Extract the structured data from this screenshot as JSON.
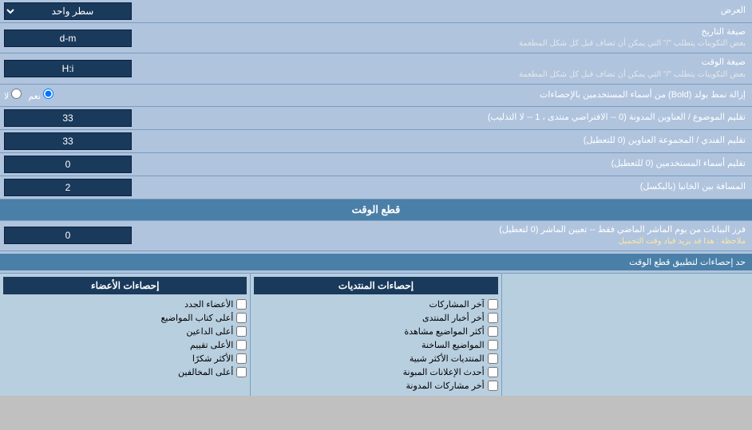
{
  "header": {
    "display_label": "العرض",
    "single_line_label": "سطر واحد"
  },
  "rows": [
    {
      "id": "date-format",
      "label": "صيغة التاريخ",
      "sublabel": "بعض التكوينات يتطلب \"/\" التي يمكن أن تضاف قبل كل شكل المطعمة",
      "value": "d-m",
      "type": "text"
    },
    {
      "id": "time-format",
      "label": "صيغة الوقت",
      "sublabel": "بعض التكوينات يتطلب \"/\" التي يمكن أن تضاف قبل كل شكل المطعمة",
      "value": "H:i",
      "type": "text"
    },
    {
      "id": "bold-usernames",
      "label": "إزالة نمط بولد (Bold) من أسماء المستخدمين بالإحصاءات",
      "value": "نعم",
      "type": "radio",
      "options": [
        "نعم",
        "لا"
      ],
      "selected": "نعم"
    },
    {
      "id": "forum-subject",
      "label": "تقليم الموضوع / العناوين المدونة (0 -- الافتراضي منتدى ، 1 -- لا التذليب)",
      "value": "33",
      "type": "text"
    },
    {
      "id": "forum-group",
      "label": "تقليم الفندي / المجموعة العناوين (0 للتعطيل)",
      "value": "33",
      "type": "text"
    },
    {
      "id": "user-names",
      "label": "تقليم أسماء المستخدمين (0 للتعطيل)",
      "value": "0",
      "type": "text"
    },
    {
      "id": "column-gap",
      "label": "المسافة بين الخانيا (بالبكسل)",
      "value": "2",
      "type": "text"
    }
  ],
  "cutoff_section": {
    "title": "قطع الوقت",
    "row_label": "فرز البيانات من يوم الماشر الماضي فقط -- تعيين الماشر (0 لتعطيل)",
    "row_note": "ملاحظة : هذا قد يزيد قياد وقت التحميل",
    "value": "0",
    "limit_label": "حد إحصاءات لتطبيق قطع الوقت"
  },
  "stats_headers": {
    "posts": "إحصاءات المنتديات",
    "members": "إحصاءات الأعضاء"
  },
  "stats_posts": [
    {
      "label": "آخر المشاركات",
      "checked": false
    },
    {
      "label": "أخر أخبار المنتدى",
      "checked": false
    },
    {
      "label": "أكثر المواضيع مشاهدة",
      "checked": false
    },
    {
      "label": "المواضيع الساخنة",
      "checked": false
    },
    {
      "label": "المنتديات الأكثر شبية",
      "checked": false
    },
    {
      "label": "أحدث الإعلانات المبونة",
      "checked": false
    },
    {
      "label": "أخر مشاركات المدونة",
      "checked": false
    }
  ],
  "stats_members": [
    {
      "label": "الأعضاء الجدد",
      "checked": false
    },
    {
      "label": "أعلى كتاب المواضيع",
      "checked": false
    },
    {
      "label": "أعلى الداعين",
      "checked": false
    },
    {
      "label": "الأعلى تقييم",
      "checked": false
    },
    {
      "label": "الأكثر شكرًا",
      "checked": false
    },
    {
      "label": "أعلى المخالفين",
      "checked": false
    }
  ],
  "stats_members_col1": [
    {
      "label": "الأعضاء الجدد",
      "checked": false
    },
    {
      "label": "أعلى كتاب المواضيع",
      "checked": false
    },
    {
      "label": "أعلى الداعين",
      "checked": false
    },
    {
      "label": "الأعلى تقييم",
      "checked": false
    },
    {
      "label": "الأكثر شكرًا",
      "checked": false
    },
    {
      "label": "أعلى المخالفين",
      "checked": false
    }
  ],
  "icons": {
    "dropdown": "▼",
    "radio_on": "●",
    "radio_off": "○"
  }
}
